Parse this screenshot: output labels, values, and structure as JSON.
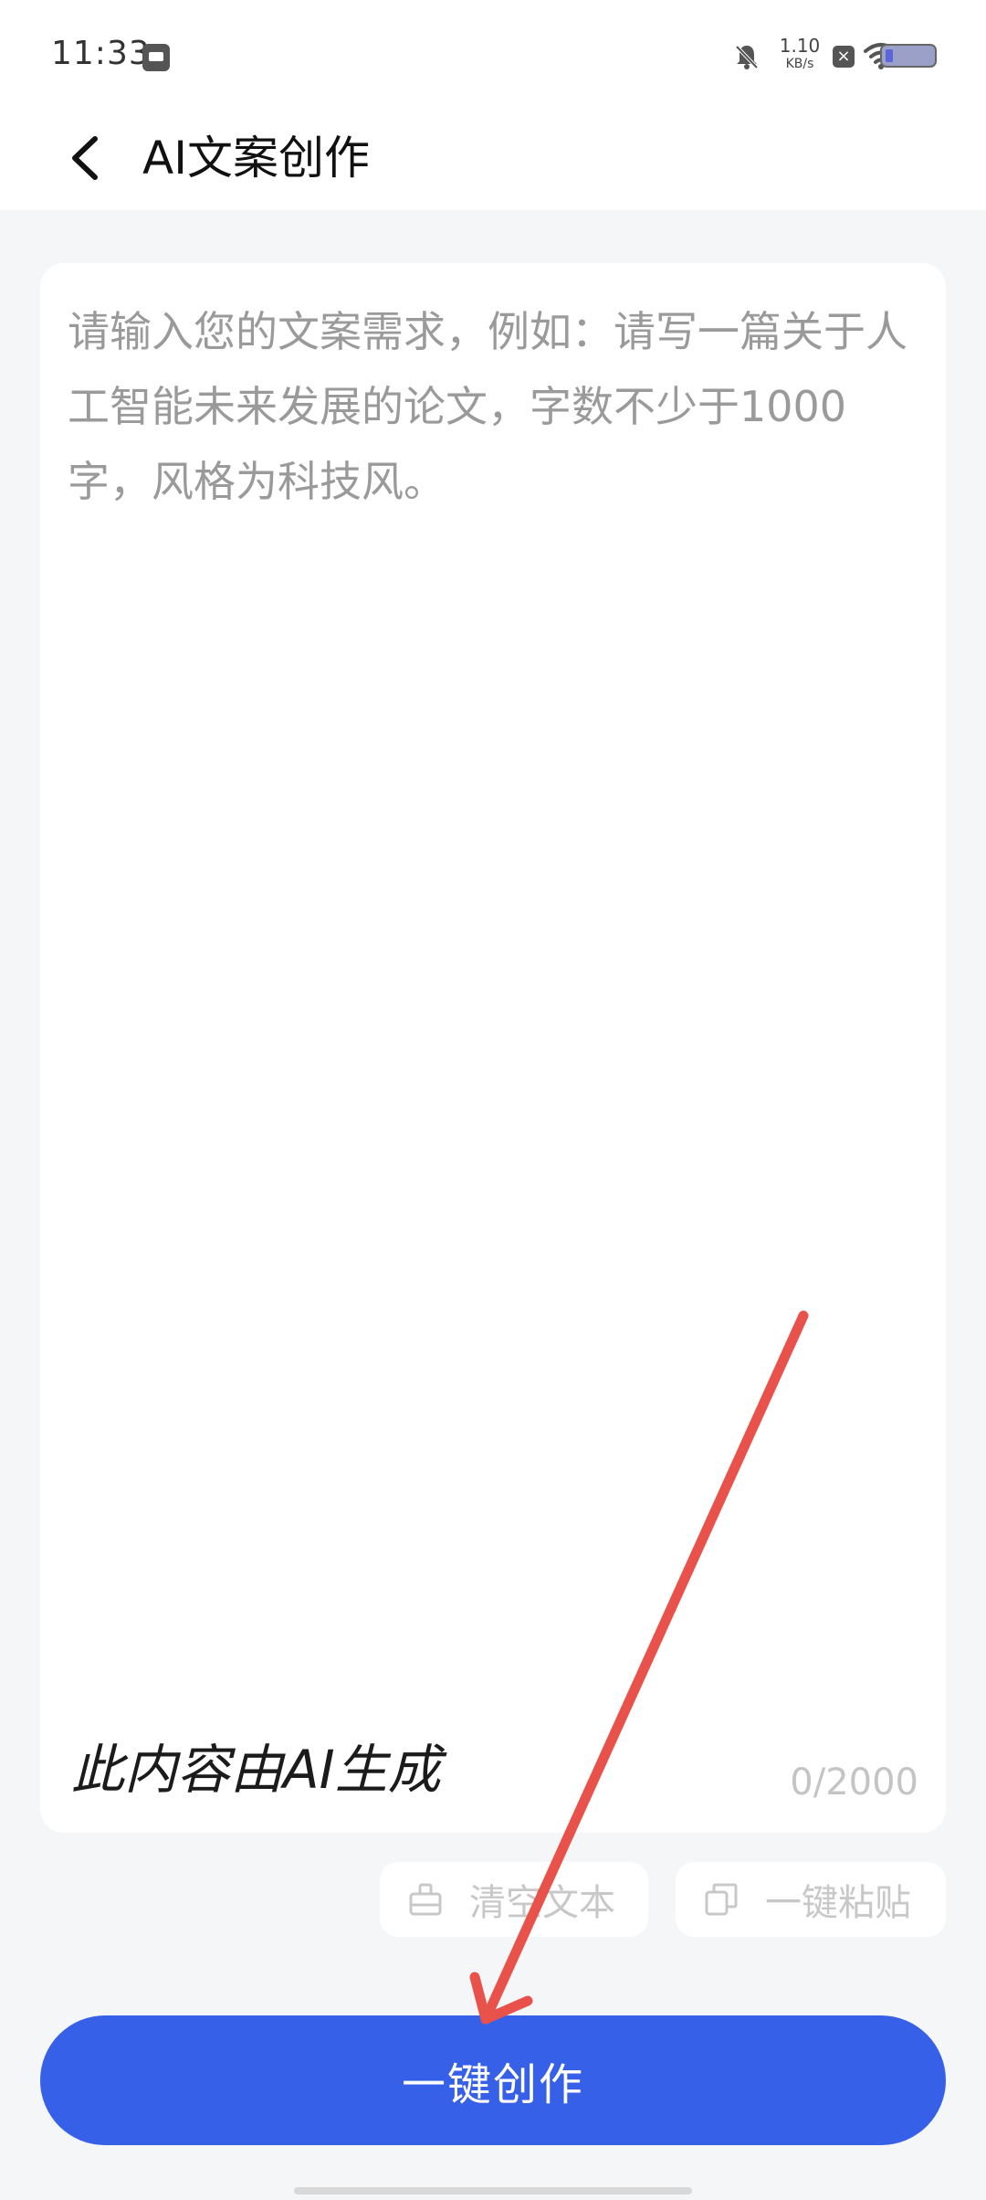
{
  "status_bar": {
    "time": "11:33",
    "net_speed_value": "1.10",
    "net_speed_unit": "KB/s"
  },
  "header": {
    "title": "AI文案创作"
  },
  "editor": {
    "placeholder": "请输入您的文案需求，例如：请写一篇关于人工智能未来发展的论文，字数不少于1000字，风格为科技风。",
    "watermark": "此内容由AI生成",
    "counter": "0/2000"
  },
  "tools": {
    "clear_label": "清空文本",
    "paste_label": "一键粘贴"
  },
  "primary": {
    "create_label": "一键创作"
  },
  "colors": {
    "accent": "#3760E8",
    "annotation_arrow": "#E8524A"
  }
}
